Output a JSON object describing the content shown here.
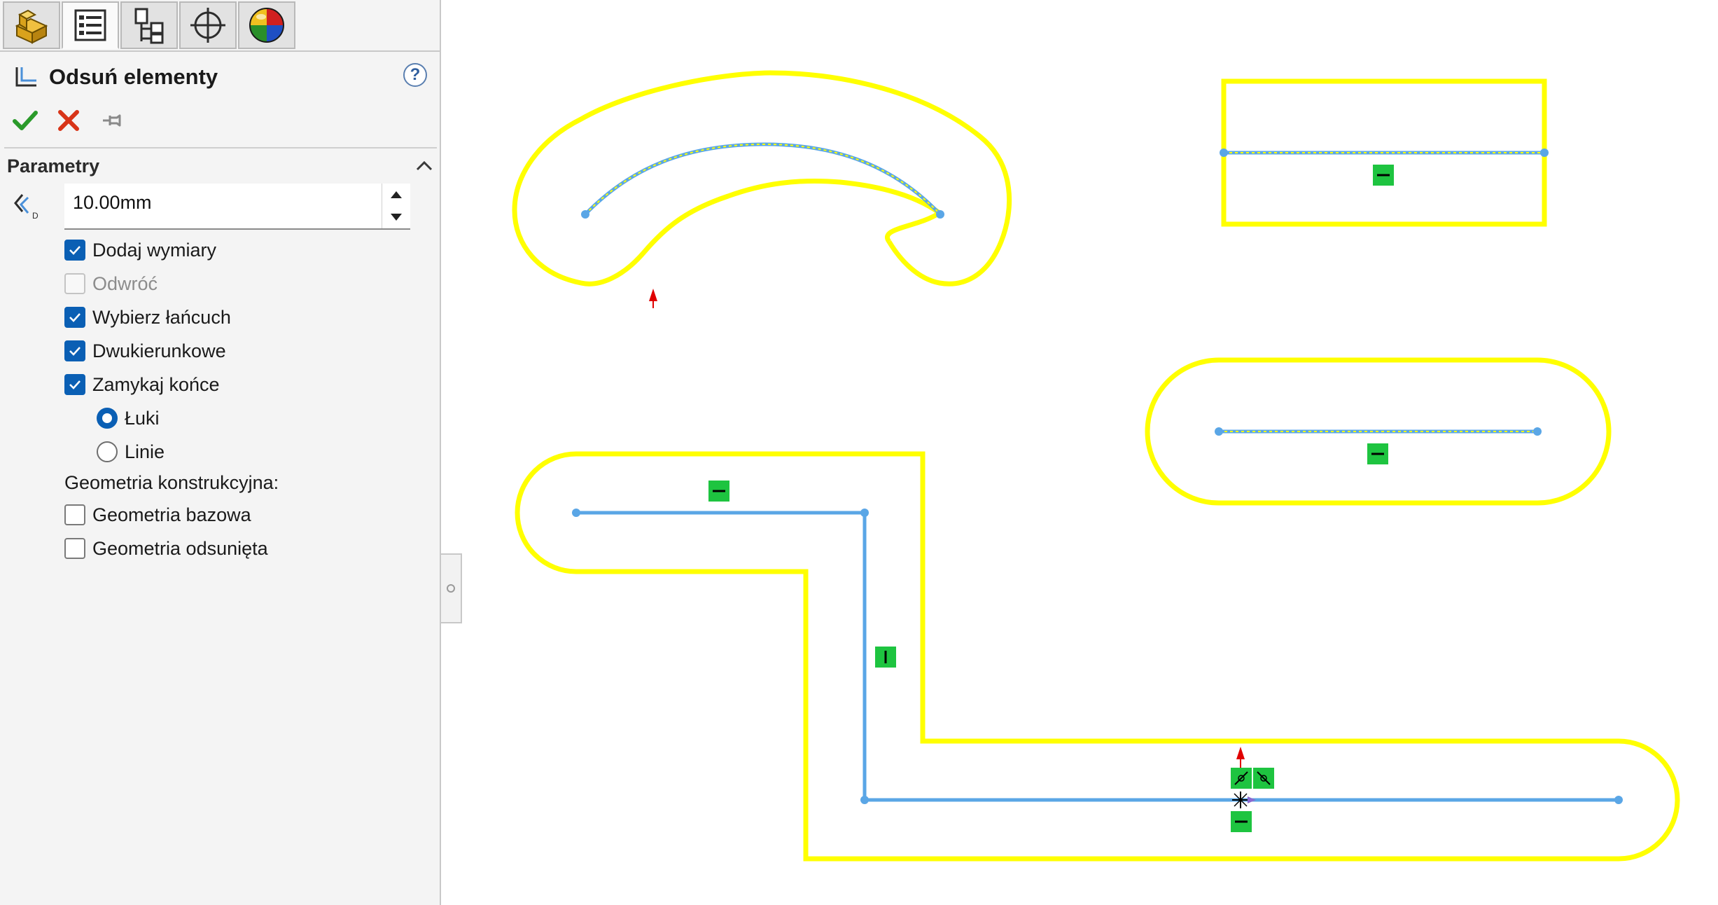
{
  "panel": {
    "tabs": [
      {
        "name": "featuremanager-tab",
        "icon": "part-icon"
      },
      {
        "name": "propertymanager-tab",
        "icon": "property-list-icon"
      },
      {
        "name": "configurationmanager-tab",
        "icon": "configuration-icon"
      },
      {
        "name": "dimxpert-tab",
        "icon": "crosshair-icon"
      },
      {
        "name": "appearance-tab",
        "icon": "appearance-sphere-icon"
      }
    ],
    "active_tab": 1,
    "title": "Odsuń elementy",
    "help_label": "?",
    "actions": {
      "ok_icon": "check-icon",
      "cancel_icon": "x-icon",
      "pin_icon": "pushpin-icon"
    },
    "group_title": "Parametry",
    "distance_value": "10.00mm",
    "options": {
      "add_dimensions": {
        "label": "Dodaj wymiary",
        "checked": true
      },
      "reverse": {
        "label": "Odwróć",
        "checked": false,
        "disabled": true
      },
      "select_chain": {
        "label": "Wybierz łańcuch",
        "checked": true
      },
      "bidirectional": {
        "label": "Dwukierunkowe",
        "checked": true
      },
      "cap_ends": {
        "label": "Zamykaj końce",
        "checked": true
      },
      "arcs": {
        "label": "Łuki",
        "selected": true
      },
      "lines": {
        "label": "Linie",
        "selected": false
      },
      "construction_label": "Geometria konstrukcyjna:",
      "base_geometry": {
        "label": "Geometria bazowa",
        "checked": false
      },
      "offset_geometry": {
        "label": "Geometria odsunięta",
        "checked": false
      }
    }
  },
  "colors": {
    "offset_entity": "#ffff00",
    "selected_entity": "#5aa6e6",
    "relation_badge": "#1ec440",
    "direction_arrow": "#e00000",
    "checkbox_accent": "#0a5fb4"
  },
  "canvas": {
    "relation_icons": [
      "horizontal-relation-icon",
      "vertical-relation-icon",
      "coincident-relation-icon",
      "origin-icon",
      "direction-arrow-icon"
    ]
  }
}
